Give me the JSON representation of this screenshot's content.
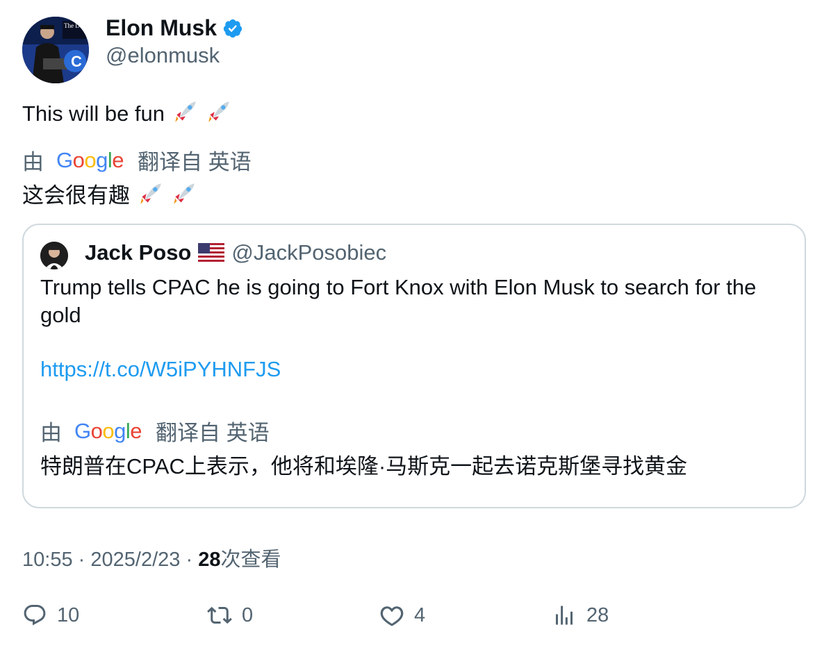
{
  "author": {
    "name": "Elon Musk",
    "handle": "@elonmusk",
    "avatar_caption": "The Dogefa"
  },
  "tweet": {
    "text": "This will be fun",
    "translated_text": "这会很有趣"
  },
  "translation": {
    "by_label": "由",
    "provider": "Google",
    "from_label": "翻译自 英语"
  },
  "quote": {
    "name": "Jack Poso",
    "flag": "us-flag",
    "handle": "@JackPosobiec",
    "text": "Trump tells CPAC he is going to Fort Knox with Elon Musk to search for the gold",
    "link": "https://t.co/W5iPYHNFJS",
    "translated_text": "特朗普在CPAC上表示，他将和埃隆·马斯克一起去诺克斯堡寻找黄金"
  },
  "meta": {
    "time": "10:55",
    "separator": "·",
    "date": "2025/2/23",
    "views_count": "28",
    "views_label": "次查看"
  },
  "actions": {
    "replies": "10",
    "retweets": "0",
    "likes": "4",
    "views": "28"
  },
  "colors": {
    "accent": "#1d9bf0",
    "secondary_text": "#536471",
    "primary_text": "#0f1419",
    "border": "#cfd9de"
  }
}
